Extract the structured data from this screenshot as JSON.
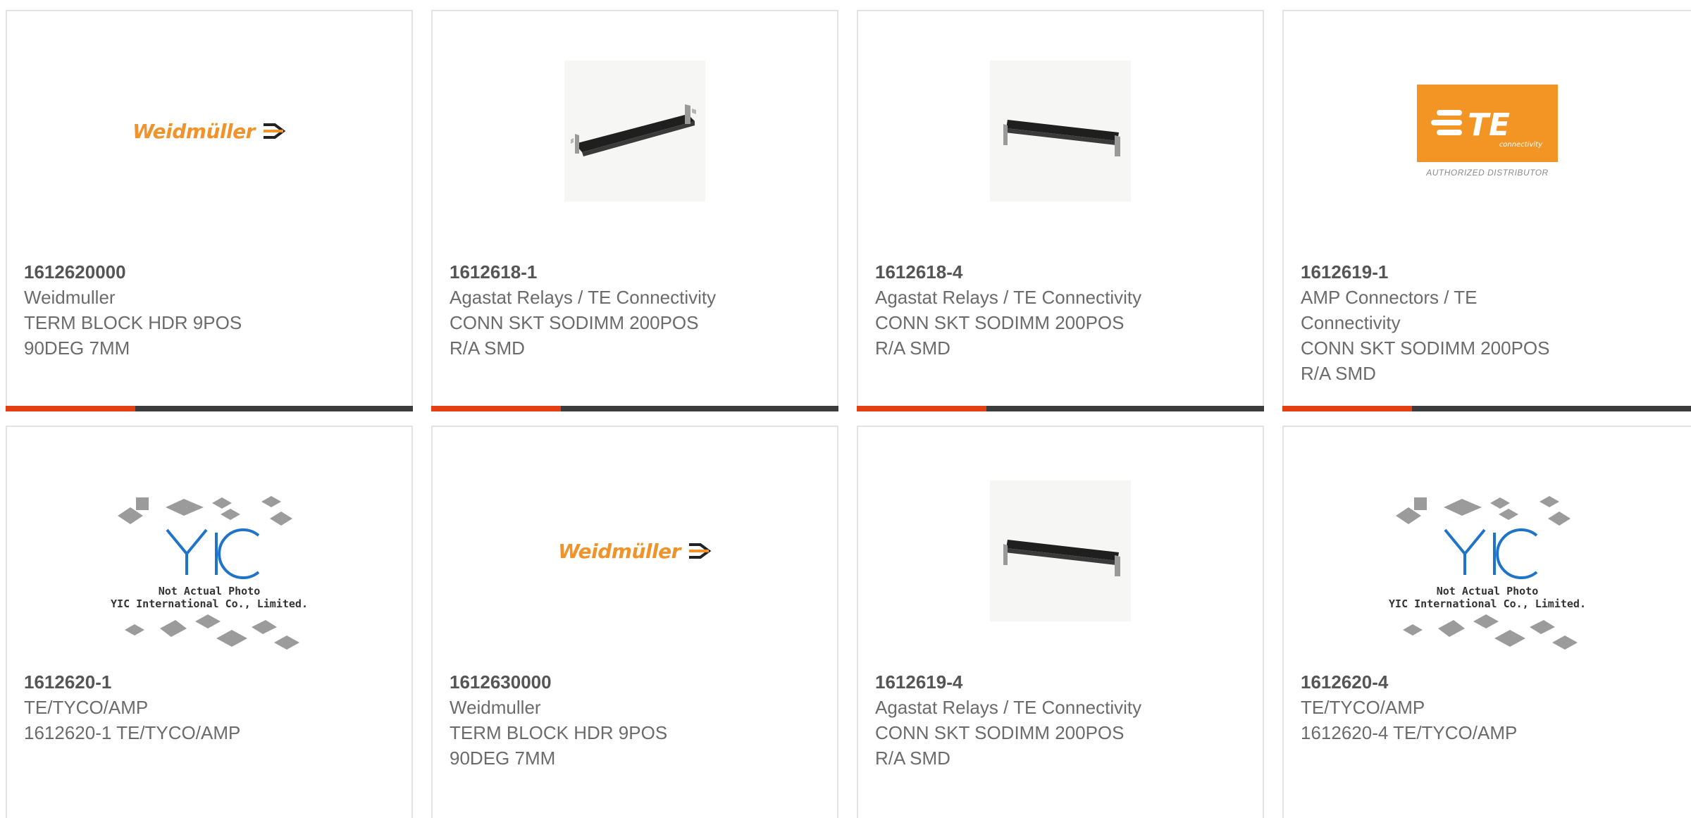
{
  "cards": [
    {
      "part_number": "1612620000",
      "manufacturer": "Weidmuller",
      "desc_lines": [
        "TERM BLOCK HDR 9POS",
        "90DEG 7MM"
      ],
      "image": "weidmuller-logo",
      "logo_text": "Weidmüller"
    },
    {
      "part_number": "1612618-1",
      "manufacturer": "Agastat Relays / TE Connectivity",
      "desc_lines": [
        "CONN SKT SODIMM 200POS",
        "R/A SMD"
      ],
      "image": "connector-photo"
    },
    {
      "part_number": "1612618-4",
      "manufacturer": "Agastat Relays / TE Connectivity",
      "desc_lines": [
        "CONN SKT SODIMM 200POS",
        "R/A SMD"
      ],
      "image": "connector-photo"
    },
    {
      "part_number": "1612619-1",
      "manufacturer_lines": [
        "AMP Connectors / TE",
        "Connectivity"
      ],
      "desc_lines": [
        "CONN SKT SODIMM 200POS",
        "R/A SMD"
      ],
      "image": "te-logo",
      "logo_text": "TE",
      "logo_sub": "connectivity",
      "logo_caption": "AUTHORIZED DISTRIBUTOR"
    },
    {
      "part_number": "1612620-1",
      "manufacturer": "TE/TYCO/AMP",
      "desc_lines": [
        "1612620-1 TE/TYCO/AMP"
      ],
      "image": "yic-placeholder",
      "placeholder_lines": [
        "Not Actual Photo",
        "YIC International Co., Limited."
      ]
    },
    {
      "part_number": "1612630000",
      "manufacturer": "Weidmuller",
      "desc_lines": [
        "TERM BLOCK HDR 9POS",
        "90DEG 7MM"
      ],
      "image": "weidmuller-logo",
      "logo_text": "Weidmüller"
    },
    {
      "part_number": "1612619-4",
      "manufacturer": "Agastat Relays / TE Connectivity",
      "desc_lines": [
        "CONN SKT SODIMM 200POS",
        "R/A SMD"
      ],
      "image": "connector-photo"
    },
    {
      "part_number": "1612620-4",
      "manufacturer": "TE/TYCO/AMP",
      "desc_lines": [
        "1612620-4 TE/TYCO/AMP"
      ],
      "image": "yic-placeholder",
      "placeholder_lines": [
        "Not Actual Photo",
        "YIC International Co., Limited."
      ]
    }
  ],
  "colors": {
    "accent": "#e43e13",
    "bar": "#3c3c3c",
    "weidmuller_orange": "#f0932b",
    "te_orange": "#f39525",
    "yic_blue": "#1f74c9"
  }
}
